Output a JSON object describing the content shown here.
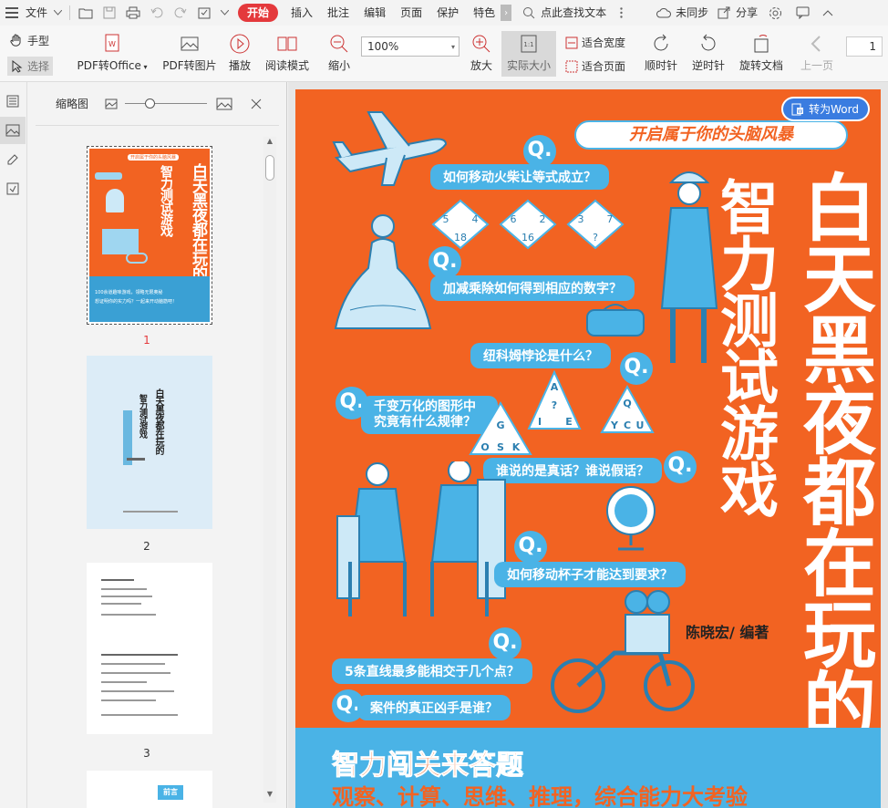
{
  "menubar": {
    "file": "文件",
    "tabs": [
      "开始",
      "插入",
      "批注",
      "编辑",
      "页面",
      "保护",
      "特色"
    ],
    "active_tab": "开始",
    "search_placeholder": "点此查找文本",
    "sync": "未同步",
    "share": "分享"
  },
  "toolbar": {
    "hand": "手型",
    "select": "选择",
    "pdf_office": "PDF转Office",
    "pdf_image": "PDF转图片",
    "play": "播放",
    "read_mode": "阅读模式",
    "zoom_out": "缩小",
    "zoom_value": "100%",
    "zoom_in": "放大",
    "actual_size": "实际大小",
    "fit_width": "适合宽度",
    "fit_page": "适合页面",
    "rotate_cw": "顺时针",
    "rotate_ccw": "逆时针",
    "rotate_doc": "旋转文档",
    "prev_page": "上一页",
    "page_number": "1"
  },
  "thumbs": {
    "title": "缩略图",
    "labels": [
      "1",
      "2",
      "3"
    ]
  },
  "cover": {
    "word_button": "转为Word",
    "banner": "开启属于你的头脑风暴",
    "title_col1": "白天黑夜都在玩的",
    "title_col2": "智力测试游戏",
    "author": "陈晓宏/ 编著",
    "q_label": "Q.",
    "questions": [
      "如何移动火柴让等式成立？",
      "加减乘除如何得到相应的数字？",
      "纽科姆悖论是什么？",
      "千变万化的图形中究竟有什么规律？",
      "谁说的是真话？谁说假话？",
      "如何移动杯子才能达到要求？",
      "5条直线最多能相交于几个点？",
      "案件的真正凶手是谁？"
    ],
    "bottom_line1": "智力闯关来答题",
    "bottom_line2": "观察、计算、思维、推理，综合能力大考验",
    "diamonds": [
      "5",
      "4",
      "6",
      "2",
      "3",
      "7",
      "18",
      "16",
      "?"
    ],
    "triangle1": [
      "A",
      "?",
      "I",
      "E"
    ],
    "triangle2": [
      "Q",
      "Y",
      "C",
      "U"
    ],
    "triangle3": [
      "G",
      "O",
      "S",
      "K"
    ],
    "thumb1_line": "开启属于你的头脑风暴",
    "thumb1_bottom": "100余道趣味游戏，领略无限奥秘",
    "thumb1_bottom2": "想证明你的实力吗？一起来开动脑筋吧！",
    "thumb3_heading": "前言"
  },
  "colors": {
    "cover_orange": "#f26322",
    "cover_blue": "#4ab3e6",
    "active_tab": "#e4393c",
    "word_button": "#3a7ce0"
  }
}
